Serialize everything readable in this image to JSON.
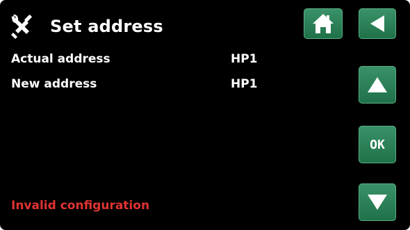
{
  "header": {
    "title": "Set address",
    "icon": "tools-icon"
  },
  "settings": [
    {
      "label": "Actual address",
      "value": "HP1"
    },
    {
      "label": "New address",
      "value": "HP1"
    }
  ],
  "status": {
    "message": "Invalid configuration",
    "color": "#e03333"
  },
  "buttons": {
    "home_icon": "home-icon",
    "back_icon": "back-arrow-icon",
    "up_icon": "up-arrow-icon",
    "ok_label": "OK",
    "down_icon": "down-arrow-icon"
  },
  "colors": {
    "background": "#000000",
    "button": "#2a8a5c",
    "text": "#ffffff"
  }
}
